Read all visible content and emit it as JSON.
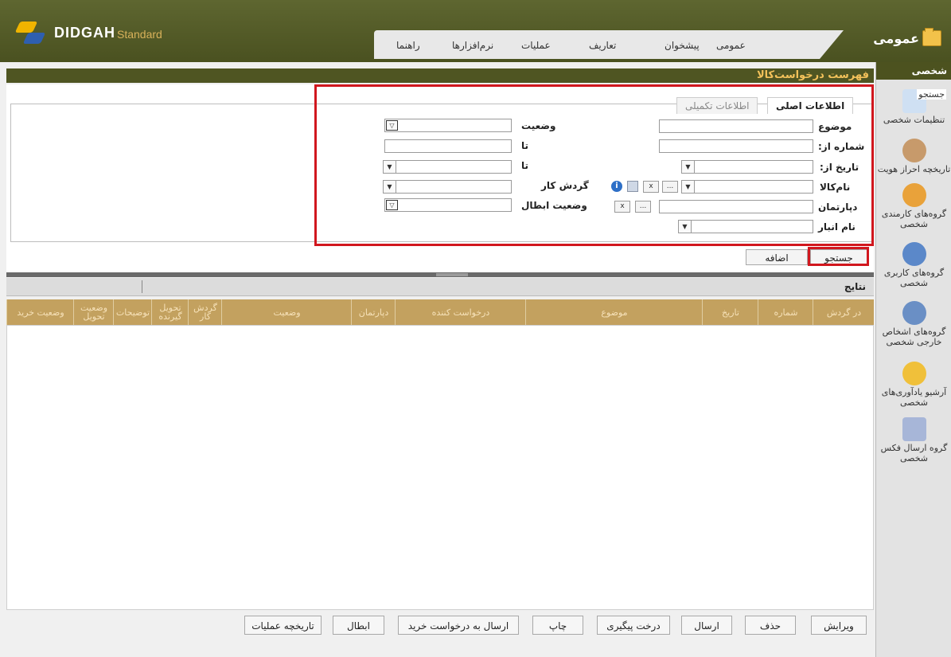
{
  "header": {
    "logo_text": "DIDGAH",
    "logo_sub": "Standard",
    "brand": "عمومی",
    "menu": [
      "عمومی",
      "پیشخوان",
      "تعاریف",
      "عملیات",
      "نرم‌افزارها",
      "راهنما"
    ]
  },
  "sidebar": {
    "title": "شخصی",
    "items": [
      {
        "label": "تنظیمات شخصی",
        "icon": "settings-pen-icon"
      },
      {
        "label": "تاریخچه احراز هویت",
        "icon": "user-history-icon"
      },
      {
        "label": "گروه‌های کارمندی شخصی",
        "icon": "employee-group-icon"
      },
      {
        "label": "گروه‌های کاربری شخصی",
        "icon": "user-group-icon"
      },
      {
        "label": "گروه‌های اشخاص خارجی شخصی",
        "icon": "external-group-icon"
      },
      {
        "label": "آرشیو یادآوری‌های شخصی",
        "icon": "bell-icon"
      },
      {
        "label": "گروه ارسال فکس شخصی",
        "icon": "fax-group-icon"
      }
    ]
  },
  "page": {
    "title": "فهرست درخواست‌کالا"
  },
  "search": {
    "legend": "جستجو",
    "tabs": [
      "اطلاعات اصلی",
      "اطلاعات تکمیلی"
    ],
    "labels": {
      "subject": "موضوع",
      "number_from": "شماره از:",
      "date_from": "تاریخ از:",
      "item_name": "نام‌کالا",
      "department": "دپارتمان",
      "warehouse": "نام انبار",
      "status": "وضعیت",
      "to1": "تا",
      "to2": "تا",
      "workflow": "گردش کار",
      "cancel_status": "وضعیت ابطال"
    },
    "search_button": "جستجو",
    "add_button": "اضافه"
  },
  "results": {
    "title": "نتایج",
    "columns": [
      "در گردش",
      "شماره",
      "تاریخ",
      "موضوع",
      "درخواست کننده",
      "دپارتمان",
      "وضعیت",
      "گردش کار",
      "تحویل گیرنده",
      "توضیحات",
      "وضعیت تحویل",
      "وضعیت خرید"
    ]
  },
  "actions": [
    "ویرایش",
    "حذف",
    "ارسال",
    "درخت پیگیری",
    "چاپ",
    "ارسال به درخواست خرید",
    "ابطال",
    "تاریخچه عملیات"
  ],
  "colors": {
    "header_bg": "#4f5522",
    "accent": "#c3a15f",
    "highlight": "#d1171e"
  }
}
